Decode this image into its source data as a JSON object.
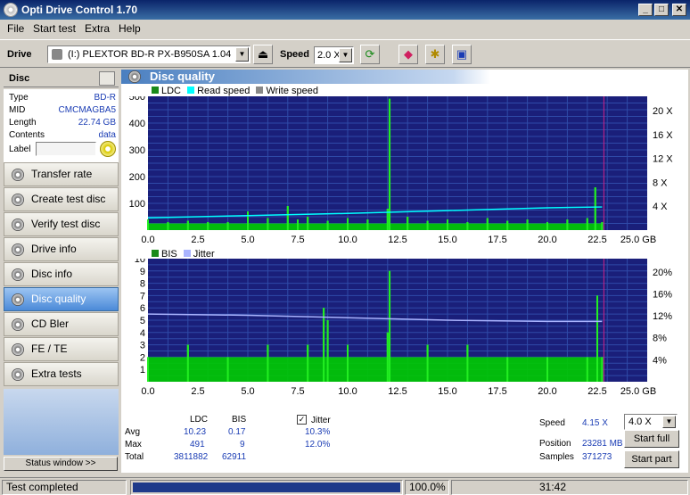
{
  "window": {
    "title": "Opti Drive Control 1.70",
    "min": "_",
    "max": "□",
    "close": "✕"
  },
  "menu": [
    "File",
    "Start test",
    "Extra",
    "Help"
  ],
  "toolbar": {
    "drive_label": "Drive",
    "drive_value": "(I:)  PLEXTOR BD-R  PX-B950SA 1.04",
    "speed_label": "Speed",
    "speed_value": "2.0 X"
  },
  "disc": {
    "header": "Disc",
    "type_k": "Type",
    "type_v": "BD-R",
    "mid_k": "MID",
    "mid_v": "CMCMAGBA5",
    "length_k": "Length",
    "length_v": "22.74 GB",
    "contents_k": "Contents",
    "contents_v": "data",
    "label_k": "Label"
  },
  "nav": [
    "Transfer rate",
    "Create test disc",
    "Verify test disc",
    "Drive info",
    "Disc info",
    "Disc quality",
    "CD Bler",
    "FE / TE",
    "Extra tests"
  ],
  "nav_active": 5,
  "status_window": "Status window >>",
  "section_title": "Disc quality",
  "legend1": {
    "ldc": "LDC",
    "read": "Read speed",
    "write": "Write speed"
  },
  "legend2": {
    "bis": "BIS",
    "jitter": "Jitter"
  },
  "colors": {
    "plot_bg": "#1a1f7a",
    "green": "#00cc00",
    "ldc_spike": "#22ee22",
    "read_line": "#00ffff",
    "jitter_line": "#aab4ff",
    "end_line": "#cc2288"
  },
  "chart_data": [
    {
      "type": "area",
      "series": [
        {
          "name": "LDC",
          "x": [
            0,
            1,
            2,
            3,
            4,
            5,
            6,
            7,
            7.5,
            8,
            9,
            10,
            11,
            12,
            12.1,
            13,
            14,
            15,
            16,
            17,
            18,
            19,
            20,
            21,
            22,
            22.4,
            22.74
          ],
          "y": [
            40,
            30,
            35,
            30,
            30,
            70,
            45,
            90,
            40,
            50,
            35,
            45,
            40,
            80,
            491,
            50,
            35,
            40,
            30,
            45,
            35,
            40,
            30,
            40,
            45,
            160,
            30
          ]
        },
        {
          "name": "Read speed",
          "x": [
            0,
            5,
            10,
            15,
            20,
            22.74
          ],
          "y": [
            2.2,
            2.6,
            3.0,
            3.5,
            4.0,
            4.15
          ]
        }
      ],
      "ylim": [
        0,
        500
      ],
      "y2lim": [
        0,
        24
      ],
      "xlim": [
        0,
        25
      ],
      "yticks": [
        100,
        200,
        300,
        400,
        500
      ],
      "y2ticks": [
        "4 X",
        "8 X",
        "12 X",
        "16 X",
        "20 X"
      ],
      "xticks": [
        "0.0",
        "2.5",
        "5.0",
        "7.5",
        "10.0",
        "12.5",
        "15.0",
        "17.5",
        "20.0",
        "22.5",
        "25.0 GB"
      ]
    },
    {
      "type": "bar",
      "series": [
        {
          "name": "BIS",
          "x": [
            0,
            2,
            4,
            6,
            8,
            8.8,
            9,
            10,
            12,
            12.1,
            14,
            16,
            18,
            20,
            22,
            22.5,
            22.74
          ],
          "y": [
            2,
            3,
            2,
            3,
            3,
            6,
            5,
            3,
            4,
            9,
            3,
            3,
            2,
            2,
            2,
            7,
            2
          ]
        },
        {
          "name": "Jitter",
          "x": [
            0,
            5,
            10,
            15,
            20,
            22.74
          ],
          "y": [
            11.0,
            10.8,
            10.4,
            10.0,
            9.8,
            9.8
          ]
        }
      ],
      "ylim": [
        0,
        10
      ],
      "y2lim": [
        0,
        20
      ],
      "xlim": [
        0,
        25
      ],
      "yticks": [
        "1",
        "2",
        "3",
        "4",
        "5",
        "6",
        "7",
        "8",
        "9",
        "10"
      ],
      "y2ticks": [
        "4%",
        "8%",
        "12%",
        "16%",
        "20%"
      ],
      "xticks": [
        "0.0",
        "2.5",
        "5.0",
        "7.5",
        "10.0",
        "12.5",
        "15.0",
        "17.5",
        "20.0",
        "22.5",
        "25.0 GB"
      ]
    }
  ],
  "stats": {
    "col_ldc": "LDC",
    "col_bis": "BIS",
    "jitter_check": "Jitter",
    "avg_k": "Avg",
    "avg_ldc": "10.23",
    "avg_bis": "0.17",
    "avg_jit": "10.3%",
    "max_k": "Max",
    "max_ldc": "491",
    "max_bis": "9",
    "max_jit": "12.0%",
    "tot_k": "Total",
    "tot_ldc": "3811882",
    "tot_bis": "62911",
    "speed_k": "Speed",
    "speed_v": "4.15 X",
    "speed_sel": "4.0 X",
    "pos_k": "Position",
    "pos_v": "23281 MB",
    "samp_k": "Samples",
    "samp_v": "371273",
    "start_full": "Start full",
    "start_part": "Start part"
  },
  "status": {
    "text": "Test completed",
    "percent": "100.0%",
    "time": "31:42",
    "progress": 1.0
  }
}
